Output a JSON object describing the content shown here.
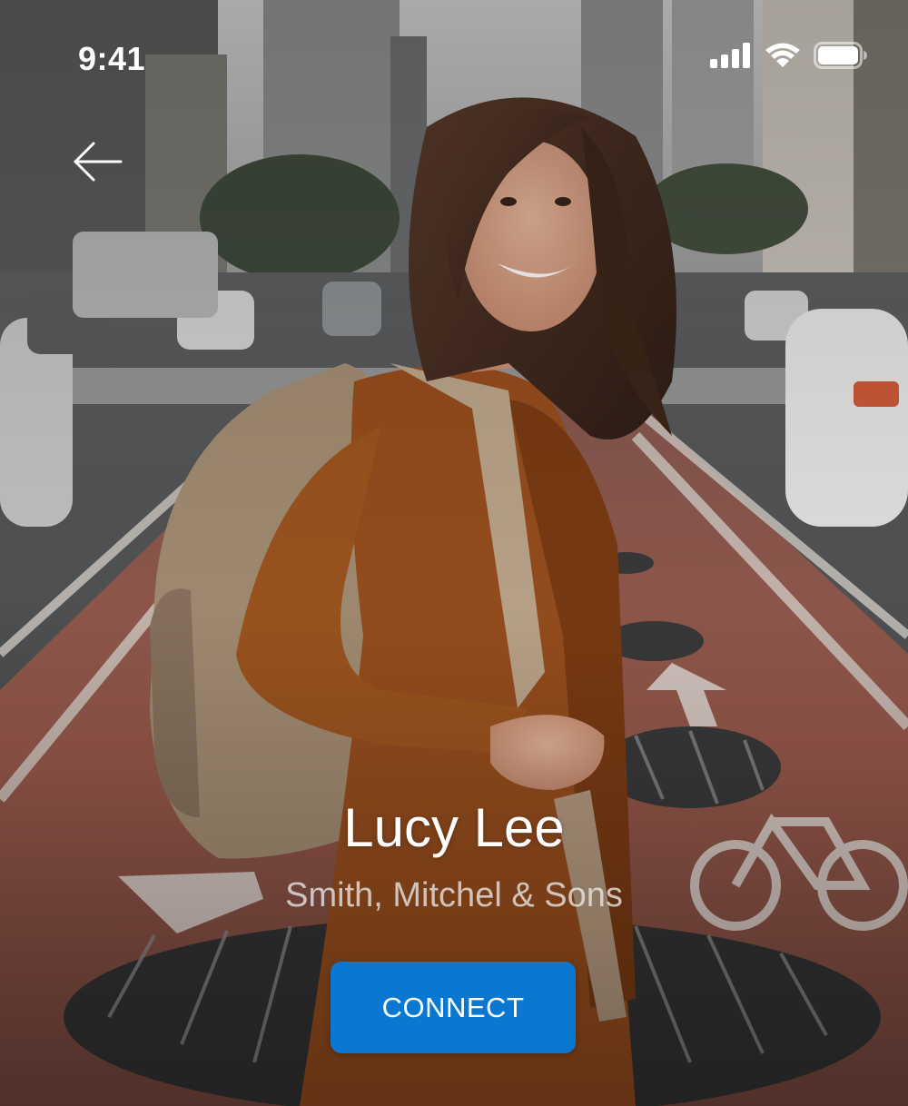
{
  "status_bar": {
    "time": "9:41",
    "icons": [
      "cellular-signal-icon",
      "wifi-icon",
      "battery-icon"
    ]
  },
  "navigation": {
    "back_icon": "arrow-left-icon"
  },
  "profile": {
    "name": "Lucy Lee",
    "company": "Smith, Mitchel & Sons"
  },
  "actions": {
    "connect_label": "CONNECT"
  },
  "colors": {
    "accent": "#0a78d0",
    "text_primary": "#ffffff",
    "text_secondary": "#e0dcdc"
  }
}
